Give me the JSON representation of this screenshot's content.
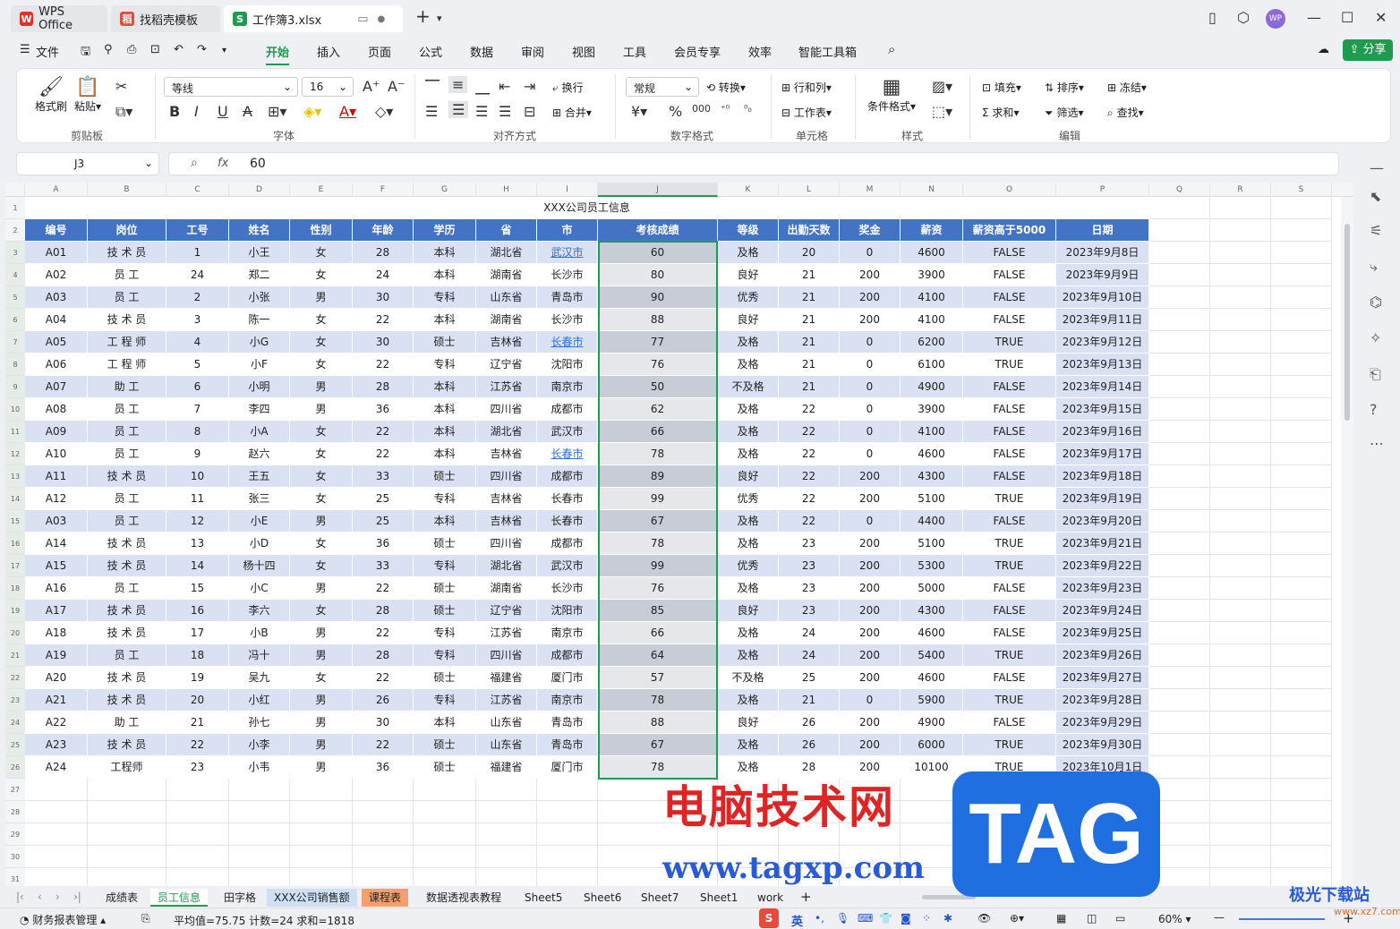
{
  "titlebar": {
    "tabs": [
      {
        "label": "WPS Office",
        "icon": "wps-logo-icon",
        "color": "#e0322a"
      },
      {
        "label": "找稻壳模板",
        "icon": "docer-icon",
        "color": "#e84a3b"
      },
      {
        "label": "工作簿3.xlsx",
        "icon": "sheet-icon",
        "color": "#1e9b4f"
      }
    ],
    "avatar": "WP"
  },
  "menu": {
    "file": "文件",
    "items": [
      "开始",
      "插入",
      "页面",
      "公式",
      "数据",
      "审阅",
      "视图",
      "工具",
      "会员专享",
      "效率",
      "智能工具箱"
    ],
    "active": "开始",
    "share": "分享"
  },
  "ribbon": {
    "clipboard": {
      "label": "剪贴板",
      "format_painter": "格式刷",
      "paste": "粘贴"
    },
    "font": {
      "label": "字体",
      "family": "等线",
      "size": "16"
    },
    "align": {
      "label": "对齐方式",
      "wrap": "换行",
      "merge": "合并"
    },
    "number": {
      "label": "数字格式",
      "format": "常规",
      "convert": "转换"
    },
    "cells": {
      "label": "单元格",
      "rowcol": "行和列",
      "sheet": "工作表"
    },
    "styles": {
      "label": "样式",
      "conditional": "条件格式"
    },
    "edit": {
      "label": "编辑",
      "fill": "填充",
      "sort": "排序",
      "freeze": "冻结",
      "sum": "求和",
      "filter": "筛选",
      "find": "查找"
    }
  },
  "formula": {
    "cell_ref": "J3",
    "fx": "fx",
    "value": "60"
  },
  "sheet": {
    "col_letters": [
      "A",
      "B",
      "C",
      "D",
      "E",
      "F",
      "G",
      "H",
      "I",
      "J",
      "K",
      "L",
      "M",
      "N",
      "O",
      "P",
      "Q",
      "R",
      "S"
    ],
    "title": "XXX公司员工信息",
    "headers": [
      "编号",
      "岗位",
      "工号",
      "姓名",
      "性别",
      "年龄",
      "学历",
      "省",
      "市",
      "考核成绩",
      "等级",
      "出勤天数",
      "奖金",
      "薪资",
      "薪资高于5000",
      "日期"
    ],
    "rows": [
      [
        "A01",
        "技 术 员",
        "1",
        "小王",
        "女",
        "28",
        "本科",
        "湖北省",
        "武汉市",
        "60",
        "及格",
        "20",
        "0",
        "4600",
        "FALSE",
        "2023年9月8日"
      ],
      [
        "A02",
        "员 工",
        "24",
        "郑二",
        "女",
        "24",
        "本科",
        "湖南省",
        "长沙市",
        "80",
        "良好",
        "21",
        "200",
        "3900",
        "FALSE",
        "2023年9月9日"
      ],
      [
        "A03",
        "员 工",
        "2",
        "小张",
        "男",
        "30",
        "专科",
        "山东省",
        "青岛市",
        "90",
        "优秀",
        "21",
        "200",
        "4100",
        "FALSE",
        "2023年9月10日"
      ],
      [
        "A04",
        "技 术 员",
        "3",
        "陈一",
        "女",
        "22",
        "本科",
        "湖南省",
        "长沙市",
        "88",
        "良好",
        "21",
        "200",
        "4100",
        "FALSE",
        "2023年9月11日"
      ],
      [
        "A05",
        "工 程 师",
        "4",
        "小G",
        "女",
        "30",
        "硕士",
        "吉林省",
        "长春市",
        "77",
        "及格",
        "21",
        "0",
        "6200",
        "TRUE",
        "2023年9月12日"
      ],
      [
        "A06",
        "工 程 师",
        "5",
        "小F",
        "女",
        "22",
        "专科",
        "辽宁省",
        "沈阳市",
        "76",
        "及格",
        "21",
        "0",
        "6100",
        "TRUE",
        "2023年9月13日"
      ],
      [
        "A07",
        "助 工",
        "6",
        "小明",
        "男",
        "28",
        "本科",
        "江苏省",
        "南京市",
        "50",
        "不及格",
        "21",
        "0",
        "4900",
        "FALSE",
        "2023年9月14日"
      ],
      [
        "A08",
        "员 工",
        "7",
        "李四",
        "男",
        "36",
        "本科",
        "四川省",
        "成都市",
        "62",
        "及格",
        "22",
        "0",
        "3900",
        "FALSE",
        "2023年9月15日"
      ],
      [
        "A09",
        "员 工",
        "8",
        "小A",
        "女",
        "22",
        "本科",
        "湖北省",
        "武汉市",
        "66",
        "及格",
        "22",
        "0",
        "4100",
        "FALSE",
        "2023年9月16日"
      ],
      [
        "A10",
        "员 工",
        "9",
        "赵六",
        "女",
        "22",
        "本科",
        "吉林省",
        "长春市",
        "78",
        "及格",
        "22",
        "0",
        "4600",
        "FALSE",
        "2023年9月17日"
      ],
      [
        "A11",
        "技 术 员",
        "10",
        "王五",
        "女",
        "33",
        "硕士",
        "四川省",
        "成都市",
        "89",
        "良好",
        "22",
        "200",
        "4300",
        "FALSE",
        "2023年9月18日"
      ],
      [
        "A12",
        "员 工",
        "11",
        "张三",
        "女",
        "25",
        "专科",
        "吉林省",
        "长春市",
        "99",
        "优秀",
        "22",
        "200",
        "5100",
        "TRUE",
        "2023年9月19日"
      ],
      [
        "A03",
        "员 工",
        "12",
        "小E",
        "男",
        "25",
        "本科",
        "吉林省",
        "长春市",
        "67",
        "及格",
        "22",
        "0",
        "4400",
        "FALSE",
        "2023年9月20日"
      ],
      [
        "A14",
        "技 术 员",
        "13",
        "小D",
        "女",
        "36",
        "硕士",
        "四川省",
        "成都市",
        "78",
        "及格",
        "23",
        "200",
        "5100",
        "TRUE",
        "2023年9月21日"
      ],
      [
        "A15",
        "技 术 员",
        "14",
        "杨十四",
        "女",
        "33",
        "专科",
        "湖北省",
        "武汉市",
        "99",
        "优秀",
        "23",
        "200",
        "5300",
        "TRUE",
        "2023年9月22日"
      ],
      [
        "A16",
        "员 工",
        "15",
        "小C",
        "男",
        "22",
        "硕士",
        "湖南省",
        "长沙市",
        "76",
        "及格",
        "23",
        "200",
        "5000",
        "FALSE",
        "2023年9月23日"
      ],
      [
        "A17",
        "技 术 员",
        "16",
        "李六",
        "女",
        "28",
        "硕士",
        "辽宁省",
        "沈阳市",
        "85",
        "良好",
        "23",
        "200",
        "4300",
        "FALSE",
        "2023年9月24日"
      ],
      [
        "A18",
        "技 术 员",
        "17",
        "小B",
        "男",
        "22",
        "专科",
        "江苏省",
        "南京市",
        "66",
        "及格",
        "24",
        "200",
        "4600",
        "FALSE",
        "2023年9月25日"
      ],
      [
        "A19",
        "员 工",
        "18",
        "冯十",
        "男",
        "28",
        "专科",
        "四川省",
        "成都市",
        "64",
        "及格",
        "24",
        "200",
        "5400",
        "TRUE",
        "2023年9月26日"
      ],
      [
        "A20",
        "技 术 员",
        "19",
        "吴九",
        "女",
        "22",
        "硕士",
        "福建省",
        "厦门市",
        "57",
        "不及格",
        "25",
        "200",
        "4600",
        "FALSE",
        "2023年9月27日"
      ],
      [
        "A21",
        "技 术 员",
        "20",
        "小红",
        "男",
        "26",
        "专科",
        "江苏省",
        "南京市",
        "78",
        "及格",
        "21",
        "0",
        "5900",
        "TRUE",
        "2023年9月28日"
      ],
      [
        "A22",
        "助 工",
        "21",
        "孙七",
        "男",
        "30",
        "本科",
        "山东省",
        "青岛市",
        "88",
        "良好",
        "26",
        "200",
        "4900",
        "FALSE",
        "2023年9月29日"
      ],
      [
        "A23",
        "技 术 员",
        "22",
        "小李",
        "男",
        "22",
        "硕士",
        "山东省",
        "青岛市",
        "67",
        "及格",
        "26",
        "200",
        "6000",
        "TRUE",
        "2023年9月30日"
      ],
      [
        "A24",
        "工程师",
        "23",
        "小韦",
        "男",
        "36",
        "硕士",
        "福建省",
        "厦门市",
        "78",
        "及格",
        "28",
        "200",
        "10100",
        "TRUE",
        "2023年10月1日"
      ]
    ],
    "link_rows": [
      0,
      4,
      9
    ],
    "row_numbers": [
      "1",
      "2",
      "3",
      "4",
      "5",
      "6",
      "7",
      "8",
      "9",
      "10",
      "11",
      "12",
      "13",
      "14",
      "15",
      "16",
      "17",
      "18",
      "19",
      "20",
      "21",
      "22",
      "23",
      "24",
      "25",
      "26",
      "27",
      "28",
      "29",
      "30",
      "31"
    ]
  },
  "sheet_tabs": [
    "成绩表",
    "员工信息",
    "田字格",
    "XXX公司销售额",
    "课程表",
    "数据透视表教程",
    "Sheet5",
    "Sheet6",
    "Sheet7",
    "Sheet1",
    "work"
  ],
  "active_sheet": "员工信息",
  "status": {
    "left": "财务报表管理",
    "stats": "平均值=75.75  计数=24  求和=1818",
    "ime": "英",
    "zoom": "60%"
  },
  "watermark": {
    "cn": "电脑技术网",
    "url": "www.tagxp.com",
    "tag": "TAG",
    "corner": "极光下载站",
    "corner_url": "www.xz7.com"
  },
  "colors": {
    "header_blue": "#4472c4",
    "band": "#d9e1f2",
    "accent_green": "#1e9b4f",
    "selected_col": "#c7ccd6"
  }
}
